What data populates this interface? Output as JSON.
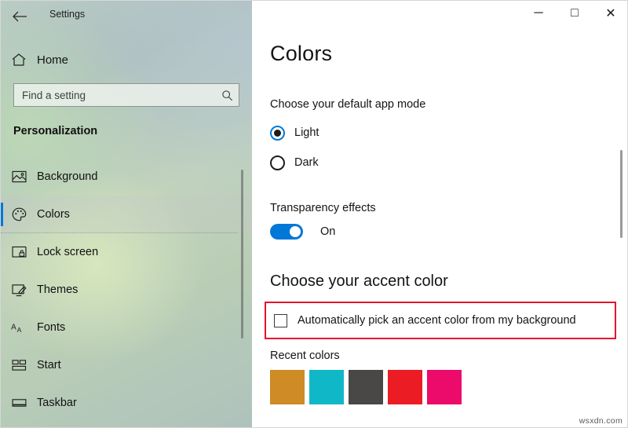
{
  "window": {
    "title": "Settings",
    "back_icon": "back-arrow-icon",
    "controls": {
      "minimize": "─",
      "maximize": "□",
      "close": "✕"
    }
  },
  "sidebar": {
    "home": {
      "label": "Home",
      "icon": "home-icon"
    },
    "search": {
      "placeholder": "Find a setting",
      "value": "",
      "icon": "search-icon"
    },
    "category": "Personalization",
    "items": [
      {
        "label": "Background",
        "icon": "image-icon",
        "selected": false
      },
      {
        "label": "Colors",
        "icon": "palette-icon",
        "selected": true
      },
      {
        "label": "Lock screen",
        "icon": "lock-screen-icon",
        "selected": false
      },
      {
        "label": "Themes",
        "icon": "themes-icon",
        "selected": false
      },
      {
        "label": "Fonts",
        "icon": "fonts-icon",
        "selected": false
      },
      {
        "label": "Start",
        "icon": "start-icon",
        "selected": false
      },
      {
        "label": "Taskbar",
        "icon": "taskbar-icon",
        "selected": false
      }
    ]
  },
  "main": {
    "page_title": "Colors",
    "app_mode": {
      "label": "Choose your default app mode",
      "options": [
        {
          "label": "Light",
          "checked": true
        },
        {
          "label": "Dark",
          "checked": false
        }
      ]
    },
    "transparency": {
      "label": "Transparency effects",
      "state": "On",
      "enabled": true
    },
    "accent": {
      "heading": "Choose your accent color",
      "auto_pick": {
        "label": "Automatically pick an accent color from my background",
        "checked": false,
        "highlighted": true
      },
      "recent_label": "Recent colors",
      "recent_colors": [
        "#ce8b26",
        "#10b8c7",
        "#494846",
        "#ec1c24",
        "#ec0a6b"
      ]
    }
  },
  "colors": {
    "accent_blue": "#0078d7",
    "highlight_red": "#e8112d"
  },
  "watermark": "wsxdn.com"
}
